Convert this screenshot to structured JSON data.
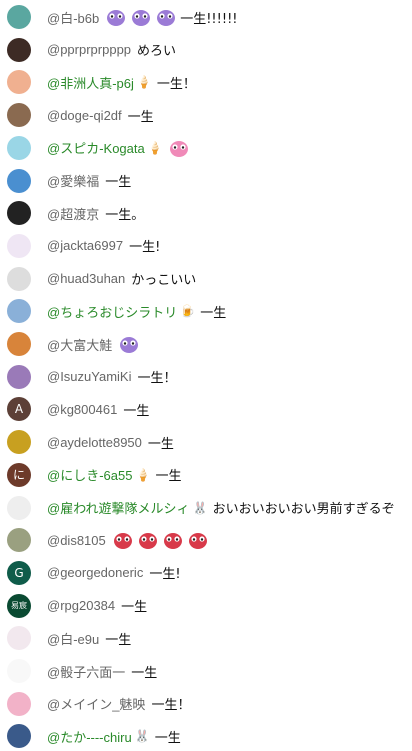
{
  "chat": {
    "rows": [
      {
        "author": "@白-b6b",
        "message": "一生!!!!!!",
        "avatar_color": "#5aa7a0",
        "avatar_letter": "",
        "member": false,
        "emojis": [
          "purple",
          "purple",
          "purple"
        ],
        "badge": ""
      },
      {
        "author": "@pprprprpppp",
        "message": "めろい",
        "avatar_color": "#3d2b25",
        "avatar_letter": "",
        "member": false,
        "emojis": [],
        "badge": ""
      },
      {
        "author": "@非洲人真-p6j",
        "message": "一生！",
        "avatar_color": "#f0b090",
        "avatar_letter": "",
        "member": true,
        "emojis": [],
        "badge": "soft-serve"
      },
      {
        "author": "@doge-qi2df",
        "message": "一生",
        "avatar_color": "#8a6a50",
        "avatar_letter": "",
        "member": false,
        "emojis": [],
        "badge": ""
      },
      {
        "author": "@スピカ-Kogata",
        "message": "",
        "avatar_color": "#9ad6e6",
        "avatar_letter": "",
        "member": true,
        "emojis": [
          "pink"
        ],
        "badge": "soft-serve"
      },
      {
        "author": "@愛樂福",
        "message": "一生",
        "avatar_color": "#4a8fd0",
        "avatar_letter": "",
        "member": false,
        "emojis": [],
        "badge": ""
      },
      {
        "author": "@超渡京",
        "message": "一生。",
        "avatar_color": "#222222",
        "avatar_letter": "",
        "member": false,
        "emojis": [],
        "badge": ""
      },
      {
        "author": "@jackta6997",
        "message": "一生!",
        "avatar_color": "#efe6f4",
        "avatar_letter": "",
        "member": false,
        "emojis": [],
        "badge": ""
      },
      {
        "author": "@huad3uhan",
        "message": "かっこいい",
        "avatar_color": "#dddddd",
        "avatar_letter": "",
        "member": false,
        "emojis": [],
        "badge": ""
      },
      {
        "author": "@ちょろおじシラトリ",
        "message": "一生",
        "avatar_color": "#8ab0d8",
        "avatar_letter": "",
        "member": true,
        "emojis": [],
        "badge": "drink"
      },
      {
        "author": "@大富大鮭",
        "message": "",
        "avatar_color": "#d8843a",
        "avatar_letter": "",
        "member": false,
        "emojis": [
          "purple"
        ],
        "badge": ""
      },
      {
        "author": "@IsuzuYamiKi",
        "message": "一生！",
        "avatar_color": "#9a7ab8",
        "avatar_letter": "",
        "member": false,
        "emojis": [],
        "badge": ""
      },
      {
        "author": "@kg800461",
        "message": "一生",
        "avatar_color": "#5d4037",
        "avatar_letter": "A",
        "member": false,
        "emojis": [],
        "badge": ""
      },
      {
        "author": "@aydelotte8950",
        "message": "一生",
        "avatar_color": "#c8a020",
        "avatar_letter": "",
        "member": false,
        "emojis": [],
        "badge": ""
      },
      {
        "author": "@にしき-6a55",
        "message": "一生",
        "avatar_color": "#6d3a2a",
        "avatar_letter": "に",
        "member": true,
        "emojis": [],
        "badge": "soft-serve"
      },
      {
        "author": "@雇われ遊撃隊メルシィ",
        "message": "おいおいおいおい男前すぎるぞ",
        "avatar_color": "#eeeeee",
        "avatar_letter": "",
        "member": true,
        "emojis": [],
        "badge": "pink-char"
      },
      {
        "author": "@dis8105",
        "message": "",
        "avatar_color": "#9aa080",
        "avatar_letter": "",
        "member": false,
        "emojis": [
          "red",
          "red",
          "red",
          "red"
        ],
        "badge": ""
      },
      {
        "author": "@georgedoneric",
        "message": "一生!",
        "avatar_color": "#0f5c4a",
        "avatar_letter": "G",
        "member": false,
        "emojis": [],
        "badge": ""
      },
      {
        "author": "@rpg20384",
        "message": "一生",
        "avatar_color": "#0a4a32",
        "avatar_letter": "易宸",
        "member": false,
        "emojis": [],
        "badge": ""
      },
      {
        "author": "@白-e9u",
        "message": "一生",
        "avatar_color": "#f2e8ee",
        "avatar_letter": "",
        "member": false,
        "emojis": [],
        "badge": ""
      },
      {
        "author": "@骰子六面一",
        "message": "一生",
        "avatar_color": "#f8f8f8",
        "avatar_letter": "",
        "member": false,
        "emojis": [],
        "badge": ""
      },
      {
        "author": "@メイイン_魅映",
        "message": "一生！",
        "avatar_color": "#f2b2c8",
        "avatar_letter": "",
        "member": false,
        "emojis": [],
        "badge": ""
      },
      {
        "author": "@たか----chiru",
        "message": "一生",
        "avatar_color": "#3a5a8a",
        "avatar_letter": "",
        "member": true,
        "emojis": [],
        "badge": "pink-char"
      }
    ]
  }
}
